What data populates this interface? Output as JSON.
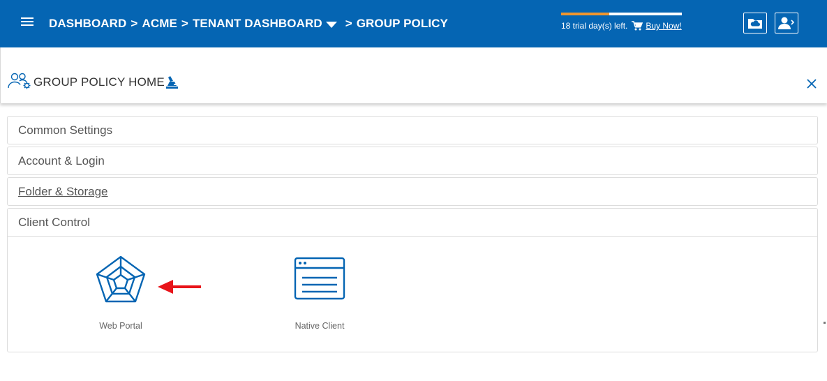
{
  "topbar": {
    "menu_icon": "hamburger-menu-icon",
    "breadcrumb": [
      "DASHBOARD",
      "ACME",
      "TENANT DASHBOARD",
      "GROUP POLICY"
    ],
    "separator": ">",
    "trial": {
      "text": "18 trial day(s) left.",
      "buy_label": "Buy Now!",
      "progress": 0.4,
      "progress_color": "#f0962e"
    },
    "buttons": [
      "cloud-folder-icon",
      "user-switch-icon"
    ],
    "bar_color": "#0565b3"
  },
  "header": {
    "title": "GROUP POLICY HOME",
    "icons": [
      "group-settings-icon",
      "policy-stamp-icon"
    ],
    "close_icon": "close-icon"
  },
  "sections": [
    {
      "title": "Common Settings"
    },
    {
      "title": "Account & Login"
    },
    {
      "title": "Folder & Storage"
    },
    {
      "title": "Client Control"
    }
  ],
  "client_control": {
    "items": [
      {
        "label": "Web Portal",
        "icon": "web-portal-icon"
      },
      {
        "label": "Native Client",
        "icon": "native-client-icon"
      }
    ],
    "accent_color": "#0565b3",
    "annotation_color": "#e8141a"
  }
}
